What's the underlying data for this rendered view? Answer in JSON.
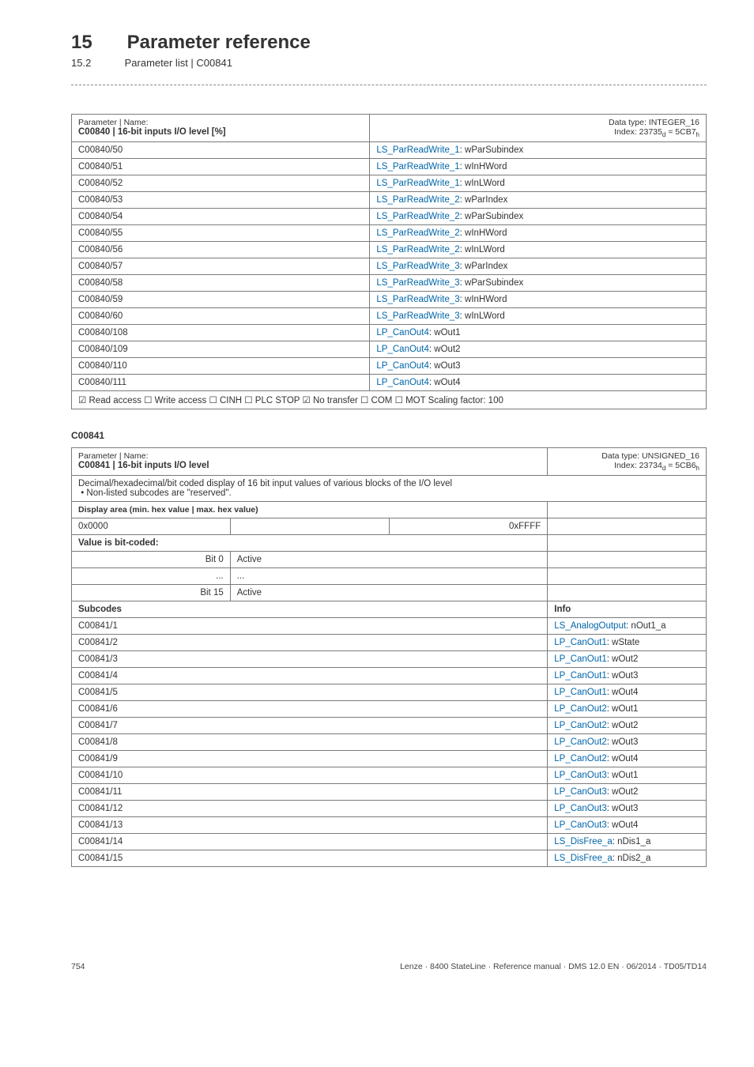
{
  "chapter": {
    "num": "15",
    "title": "Parameter reference"
  },
  "subsection": {
    "num": "15.2",
    "title": "Parameter list | C00841"
  },
  "table1": {
    "header": {
      "topLeft": "Parameter | Name:",
      "name": "C00840 | 16-bit inputs I/O level [%]",
      "dtype": "Data type: INTEGER_16",
      "index": "Index: 23735",
      "index_sub_d": "d",
      "index_eq": " = 5CB7",
      "index_sub_h": "h"
    },
    "rows": [
      {
        "code": "C00840/50",
        "link": "LS_ParReadWrite_1",
        "suffix": ": wParSubindex"
      },
      {
        "code": "C00840/51",
        "link": "LS_ParReadWrite_1",
        "suffix": ": wInHWord"
      },
      {
        "code": "C00840/52",
        "link": "LS_ParReadWrite_1",
        "suffix": ": wInLWord"
      },
      {
        "code": "C00840/53",
        "link": "LS_ParReadWrite_2",
        "suffix": ": wParIndex"
      },
      {
        "code": "C00840/54",
        "link": "LS_ParReadWrite_2",
        "suffix": ": wParSubindex"
      },
      {
        "code": "C00840/55",
        "link": "LS_ParReadWrite_2",
        "suffix": ": wInHWord"
      },
      {
        "code": "C00840/56",
        "link": "LS_ParReadWrite_2",
        "suffix": ": wInLWord"
      },
      {
        "code": "C00840/57",
        "link": "LS_ParReadWrite_3",
        "suffix": ": wParIndex"
      },
      {
        "code": "C00840/58",
        "link": "LS_ParReadWrite_3",
        "suffix": ": wParSubindex"
      },
      {
        "code": "C00840/59",
        "link": "LS_ParReadWrite_3",
        "suffix": ": wInHWord"
      },
      {
        "code": "C00840/60",
        "link": "LS_ParReadWrite_3",
        "suffix": ": wInLWord"
      },
      {
        "code": "C00840/108",
        "link": "LP_CanOut4",
        "suffix": ": wOut1"
      },
      {
        "code": "C00840/109",
        "link": "LP_CanOut4",
        "suffix": ": wOut2"
      },
      {
        "code": "C00840/110",
        "link": "LP_CanOut4",
        "suffix": ": wOut3"
      },
      {
        "code": "C00840/111",
        "link": "LP_CanOut4",
        "suffix": ": wOut4"
      }
    ],
    "footer": "☑ Read access   ☐ Write access   ☐ CINH   ☐ PLC STOP   ☑ No transfer   ☐ COM   ☐ MOT    Scaling factor: 100"
  },
  "sectionAnchor": "C00841",
  "table2": {
    "header": {
      "topLeft": "Parameter | Name:",
      "name": "C00841 | 16-bit inputs I/O level",
      "dtype": "Data type: UNSIGNED_16",
      "index": "Index: 23734",
      "index_sub_d": "d",
      "index_eq": " = 5CB6",
      "index_sub_h": "h"
    },
    "description": "Decimal/hexadecimal/bit coded display of 16 bit input values of various blocks of the I/O level",
    "bullet": "Non-listed subcodes are \"reserved\".",
    "display_area_label": "Display area (min. hex value | max. hex value)",
    "display_min": "0x0000",
    "display_max": "0xFFFF",
    "value_bit_label": "Value is bit-coded:",
    "bits": [
      {
        "label": "Bit 0",
        "val": "Active"
      },
      {
        "label": "...",
        "val": "..."
      },
      {
        "label": "Bit 15",
        "val": "Active"
      }
    ],
    "subcodes_label": "Subcodes",
    "info_label": "Info",
    "rows": [
      {
        "code": "C00841/1",
        "link": "LS_AnalogOutput",
        "suffix": ": nOut1_a"
      },
      {
        "code": "C00841/2",
        "link": "LP_CanOut1",
        "suffix": ": wState"
      },
      {
        "code": "C00841/3",
        "link": "LP_CanOut1",
        "suffix": ": wOut2"
      },
      {
        "code": "C00841/4",
        "link": "LP_CanOut1",
        "suffix": ": wOut3"
      },
      {
        "code": "C00841/5",
        "link": "LP_CanOut1",
        "suffix": ": wOut4"
      },
      {
        "code": "C00841/6",
        "link": "LP_CanOut2",
        "suffix": ": wOut1"
      },
      {
        "code": "C00841/7",
        "link": "LP_CanOut2",
        "suffix": ": wOut2"
      },
      {
        "code": "C00841/8",
        "link": "LP_CanOut2",
        "suffix": ": wOut3"
      },
      {
        "code": "C00841/9",
        "link": "LP_CanOut2",
        "suffix": ": wOut4"
      },
      {
        "code": "C00841/10",
        "link": "LP_CanOut3",
        "suffix": ": wOut1"
      },
      {
        "code": "C00841/11",
        "link": "LP_CanOut3",
        "suffix": ": wOut2"
      },
      {
        "code": "C00841/12",
        "link": "LP_CanOut3",
        "suffix": ": wOut3"
      },
      {
        "code": "C00841/13",
        "link": "LP_CanOut3",
        "suffix": ": wOut4"
      },
      {
        "code": "C00841/14",
        "link": "LS_DisFree_a",
        "suffix": ": nDis1_a"
      },
      {
        "code": "C00841/15",
        "link": "LS_DisFree_a",
        "suffix": ": nDis2_a"
      }
    ]
  },
  "footer": {
    "page": "754",
    "doc": "Lenze · 8400 StateLine · Reference manual · DMS 12.0 EN · 06/2014 · TD05/TD14"
  }
}
